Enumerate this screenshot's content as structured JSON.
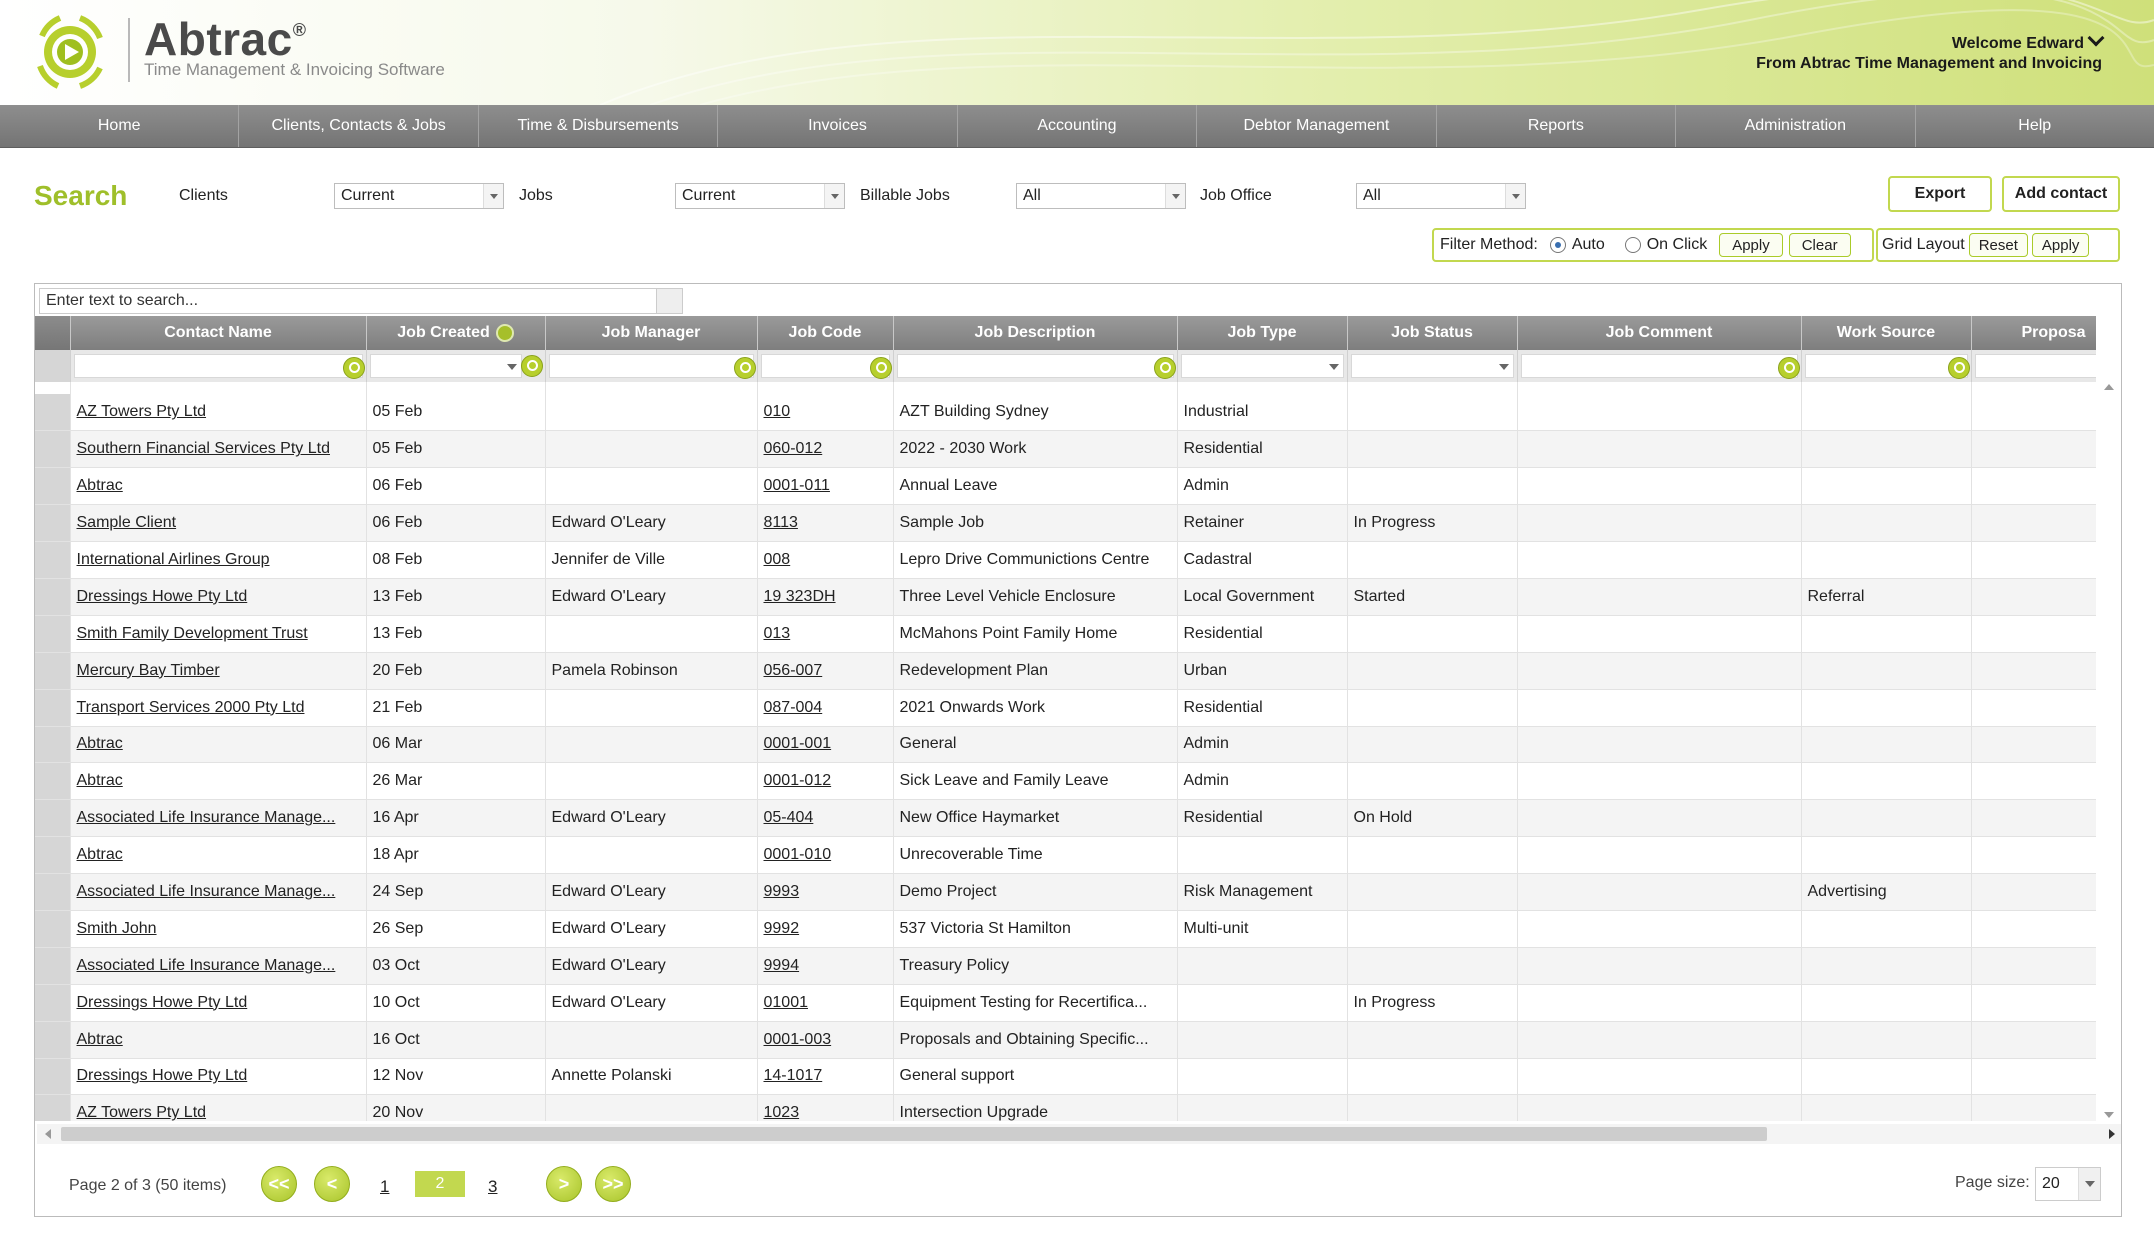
{
  "brand": {
    "name": "Abtrac",
    "reg": "®",
    "tagline": "Time Management & Invoicing Software",
    "accent": "#b7cf2d"
  },
  "user": {
    "welcome": "Welcome Edward",
    "from": "From Abtrac Time Management and Invoicing"
  },
  "nav": [
    "Home",
    "Clients, Contacts & Jobs",
    "Time & Disbursements",
    "Invoices",
    "Accounting",
    "Debtor Management",
    "Reports",
    "Administration",
    "Help"
  ],
  "search": {
    "title": "Search",
    "clients_label": "Clients",
    "clients_value": "Current",
    "jobs_label": "Jobs",
    "jobs_value": "Current",
    "billable_label": "Billable Jobs",
    "billable_value": "All",
    "office_label": "Job Office",
    "office_value": "All"
  },
  "actions": {
    "export": "Export",
    "add_contact": "Add contact",
    "filter_method": "Filter Method:",
    "auto": "Auto",
    "on_click": "On Click",
    "apply": "Apply",
    "clear": "Clear",
    "grid_layout": "Grid Layout",
    "reset": "Reset",
    "apply2": "Apply"
  },
  "grid": {
    "search_placeholder": "Enter text to search...",
    "columns": [
      "Contact Name",
      "Job Created",
      "Job Manager",
      "Job Code",
      "Job Description",
      "Job Type",
      "Job Status",
      "Job Comment",
      "Work Source",
      "Proposa"
    ],
    "rows": [
      [
        "AZ Towers Pty Ltd",
        "05 Feb",
        "",
        "010",
        "AZT Building Sydney",
        "Industrial",
        "",
        "",
        ""
      ],
      [
        "Southern Financial Services Pty Ltd",
        "05 Feb",
        "",
        "060-012",
        "2022 - 2030 Work",
        "Residential",
        "",
        "",
        ""
      ],
      [
        "Abtrac",
        "06 Feb",
        "",
        "0001-011",
        "Annual Leave",
        "Admin",
        "",
        "",
        ""
      ],
      [
        "Sample Client",
        "06 Feb",
        "Edward O'Leary",
        "8113",
        "Sample Job",
        "Retainer",
        "In Progress",
        "",
        ""
      ],
      [
        "International Airlines Group",
        "08 Feb",
        "Jennifer de Ville",
        "008",
        "Lepro Drive Communictions Centre",
        "Cadastral",
        "",
        "",
        ""
      ],
      [
        "Dressings Howe Pty Ltd",
        "13 Feb",
        "Edward O'Leary",
        "19 323DH",
        "Three Level Vehicle Enclosure",
        "Local Government",
        "Started",
        "",
        "Referral"
      ],
      [
        "Smith Family Development Trust",
        "13 Feb",
        "",
        "013",
        "McMahons Point Family Home",
        "Residential",
        "",
        "",
        ""
      ],
      [
        "Mercury Bay Timber",
        "20 Feb",
        "Pamela Robinson",
        "056-007",
        "Redevelopment Plan",
        "Urban",
        "",
        "",
        ""
      ],
      [
        "Transport Services 2000 Pty Ltd",
        "21 Feb",
        "",
        "087-004",
        "2021 Onwards Work",
        "Residential",
        "",
        "",
        ""
      ],
      [
        "Abtrac",
        "06 Mar",
        "",
        "0001-001",
        "General",
        "Admin",
        "",
        "",
        ""
      ],
      [
        "Abtrac",
        "26 Mar",
        "",
        "0001-012",
        "Sick Leave and Family Leave",
        "Admin",
        "",
        "",
        ""
      ],
      [
        "Associated Life Insurance Manage...",
        "16 Apr",
        "Edward O'Leary",
        "05-404",
        "New Office Haymarket",
        "Residential",
        "On Hold",
        "",
        ""
      ],
      [
        "Abtrac",
        "18 Apr",
        "",
        "0001-010",
        "Unrecoverable Time",
        "",
        "",
        "",
        ""
      ],
      [
        "Associated Life Insurance Manage...",
        "24 Sep",
        "Edward O'Leary",
        "9993",
        "Demo Project",
        "Risk Management",
        "",
        "",
        "Advertising"
      ],
      [
        "Smith John",
        "26 Sep",
        "Edward O'Leary",
        "9992",
        "537 Victoria St Hamilton",
        "Multi-unit",
        "",
        "",
        ""
      ],
      [
        "Associated Life Insurance Manage...",
        "03 Oct",
        "Edward O'Leary",
        "9994",
        "Treasury Policy",
        "",
        "",
        "",
        ""
      ],
      [
        "Dressings Howe Pty Ltd",
        "10 Oct",
        "Edward O'Leary",
        "01001",
        "Equipment Testing for Recertifica...",
        "",
        "In Progress",
        "",
        ""
      ],
      [
        "Abtrac",
        "16 Oct",
        "",
        "0001-003",
        "Proposals and Obtaining Specific...",
        "",
        "",
        "",
        ""
      ],
      [
        "Dressings Howe Pty Ltd",
        "12 Nov",
        "Annette Polanski",
        "14-1017",
        "General support",
        "",
        "",
        "",
        ""
      ],
      [
        "AZ Towers Pty Ltd",
        "20 Nov",
        "",
        "1023",
        "Intersection Upgrade",
        "",
        "",
        "",
        ""
      ]
    ]
  },
  "pager": {
    "info": "Page 2 of 3 (50 items)",
    "first": "<<",
    "prev": "<",
    "pages": [
      "1",
      "2",
      "3"
    ],
    "current_page": "2",
    "next": ">",
    "last": ">>",
    "size_label": "Page size:",
    "size_value": "20"
  }
}
